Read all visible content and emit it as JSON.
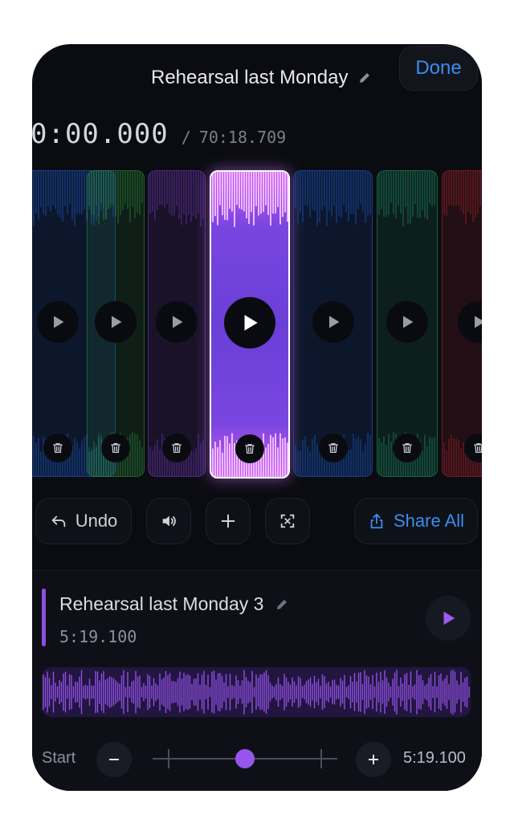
{
  "header": {
    "title": "Rehearsal last Monday",
    "edit_icon": "pencil-icon",
    "done_label": "Done"
  },
  "timer": {
    "current": "0:00.000",
    "separator": "/",
    "total": "70:18.709"
  },
  "clips": [
    {
      "name": "clip-1",
      "color": "#1f5fd6",
      "selected": false
    },
    {
      "name": "clip-2",
      "color": "#2f9a3c",
      "selected": false
    },
    {
      "name": "clip-3",
      "color": "#7a3bc4",
      "selected": false
    },
    {
      "name": "clip-4",
      "color": "#c45ee8",
      "selected": true
    },
    {
      "name": "clip-5",
      "color": "#1f5fd6",
      "selected": false
    },
    {
      "name": "clip-6",
      "color": "#1f9a6a",
      "selected": false
    },
    {
      "name": "clip-7",
      "color": "#b8232e",
      "selected": false
    }
  ],
  "toolbar": {
    "undo_label": "Undo",
    "share_label": "Share All",
    "icons": [
      "undo-icon",
      "speaker-icon",
      "plus-icon",
      "crop-icon",
      "share-icon"
    ]
  },
  "recording": {
    "title": "Rehearsal last Monday 3",
    "duration": "5:19.100",
    "accent": "#8e4fe0"
  },
  "trim": {
    "start_label": "Start",
    "end_time": "5:19.100",
    "position": 0.5
  },
  "colors": {
    "background": "#0b0c12",
    "accent_blue": "#3a8df0",
    "accent_purple": "#8e4fe0"
  }
}
